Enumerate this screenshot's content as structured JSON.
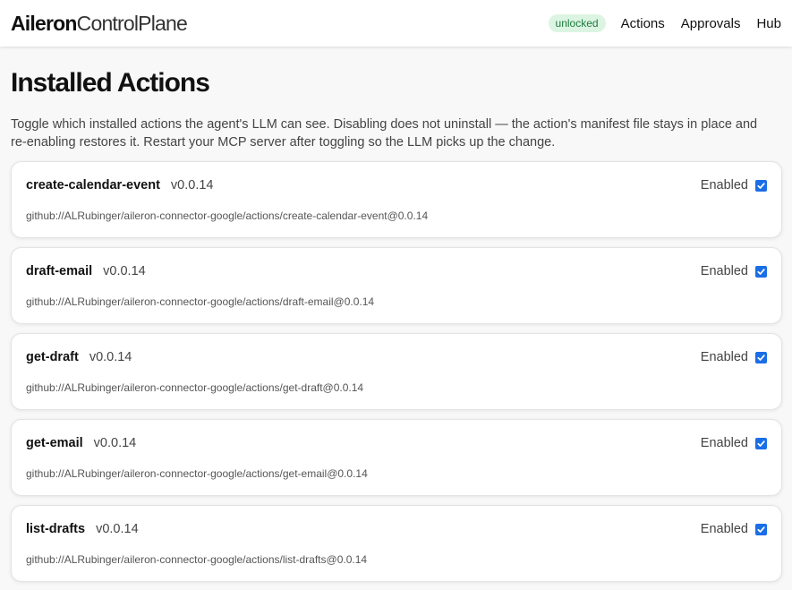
{
  "app": {
    "brand_bold": "Aileron",
    "brand_light": "ControlPlane"
  },
  "nav": {
    "status_badge": "unlocked",
    "links": [
      "Actions",
      "Approvals",
      "Hub"
    ]
  },
  "page": {
    "title": "Installed Actions",
    "description": "Toggle which installed actions the agent's LLM can see. Disabling does not uninstall — the action's manifest file stays in place and re-enabling restores it. Restart your MCP server after toggling so the LLM picks up the change."
  },
  "actions": [
    {
      "name": "create-calendar-event",
      "version": "v0.0.14",
      "toggle_label": "Enabled",
      "enabled": true,
      "source": "github://ALRubinger/aileron-connector-google/actions/create-calendar-event@0.0.14"
    },
    {
      "name": "draft-email",
      "version": "v0.0.14",
      "toggle_label": "Enabled",
      "enabled": true,
      "source": "github://ALRubinger/aileron-connector-google/actions/draft-email@0.0.14"
    },
    {
      "name": "get-draft",
      "version": "v0.0.14",
      "toggle_label": "Enabled",
      "enabled": true,
      "source": "github://ALRubinger/aileron-connector-google/actions/get-draft@0.0.14"
    },
    {
      "name": "get-email",
      "version": "v0.0.14",
      "toggle_label": "Enabled",
      "enabled": true,
      "source": "github://ALRubinger/aileron-connector-google/actions/get-email@0.0.14"
    },
    {
      "name": "list-drafts",
      "version": "v0.0.14",
      "toggle_label": "Enabled",
      "enabled": true,
      "source": "github://ALRubinger/aileron-connector-google/actions/list-drafts@0.0.14"
    }
  ],
  "colors": {
    "accent": "#1a6ee6",
    "badge_bg": "#dcf5e3",
    "badge_text": "#1f7a3d"
  },
  "icons": {
    "checkbox": "checkmark-icon"
  }
}
